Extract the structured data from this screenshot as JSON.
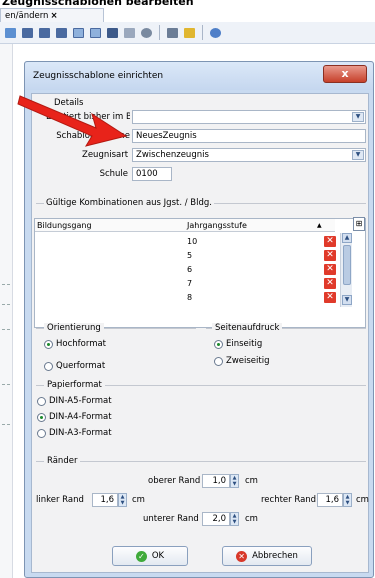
{
  "app": {
    "top_text": "Zeugnisschablonen bearbeiten",
    "tab_label": "en/ändern",
    "tab_close": "×"
  },
  "dialog": {
    "title": "Zeugnisschablone einrichten",
    "close_glyph": "x",
    "details_group": "Details",
    "exists_label": "Existiert bisher im Bildungsgang",
    "exists_value": "",
    "name_label": "Schablonenname",
    "name_value": "NeuesZeugnis",
    "type_label": "Zeugnisart",
    "type_value": "Zwischenzeugnis",
    "school_label": "Schule",
    "school_value": "0100",
    "combos_group": "Gültige Kombinationen aus Jgst. / Bldg.",
    "grid": {
      "col1": "Bildungsgang",
      "col2": "Jahrgangsstufe",
      "rows": [
        "10",
        "5",
        "6",
        "7",
        "8"
      ]
    },
    "orientation": {
      "title": "Orientierung",
      "options": [
        "Hochformat",
        "Querformat"
      ],
      "selected": "Hochformat"
    },
    "print": {
      "title": "Seitenaufdruck",
      "options": [
        "Einseitig",
        "Zweiseitig"
      ],
      "selected": "Einseitig"
    },
    "paper": {
      "title": "Papierformat",
      "options": [
        "DIN-A5-Format",
        "DIN-A4-Format",
        "DIN-A3-Format"
      ],
      "selected": "DIN-A4-Format"
    },
    "margins": {
      "title": "Ränder",
      "top_label": "oberer Rand",
      "top_value": "1,0",
      "top_unit": "cm",
      "left_label": "linker Rand",
      "left_value": "1,6",
      "left_unit": "cm",
      "right_label": "rechter Rand",
      "right_value": "1,6",
      "right_unit": "cm",
      "bottom_label": "unterer Rand",
      "bottom_value": "2,0",
      "bottom_unit": "cm"
    },
    "ok_label": "OK",
    "cancel_label": "Abbrechen"
  },
  "colors": {
    "accent": "#1c8a2c",
    "arrow": "#e8231a",
    "delete": "#e03a2a"
  }
}
